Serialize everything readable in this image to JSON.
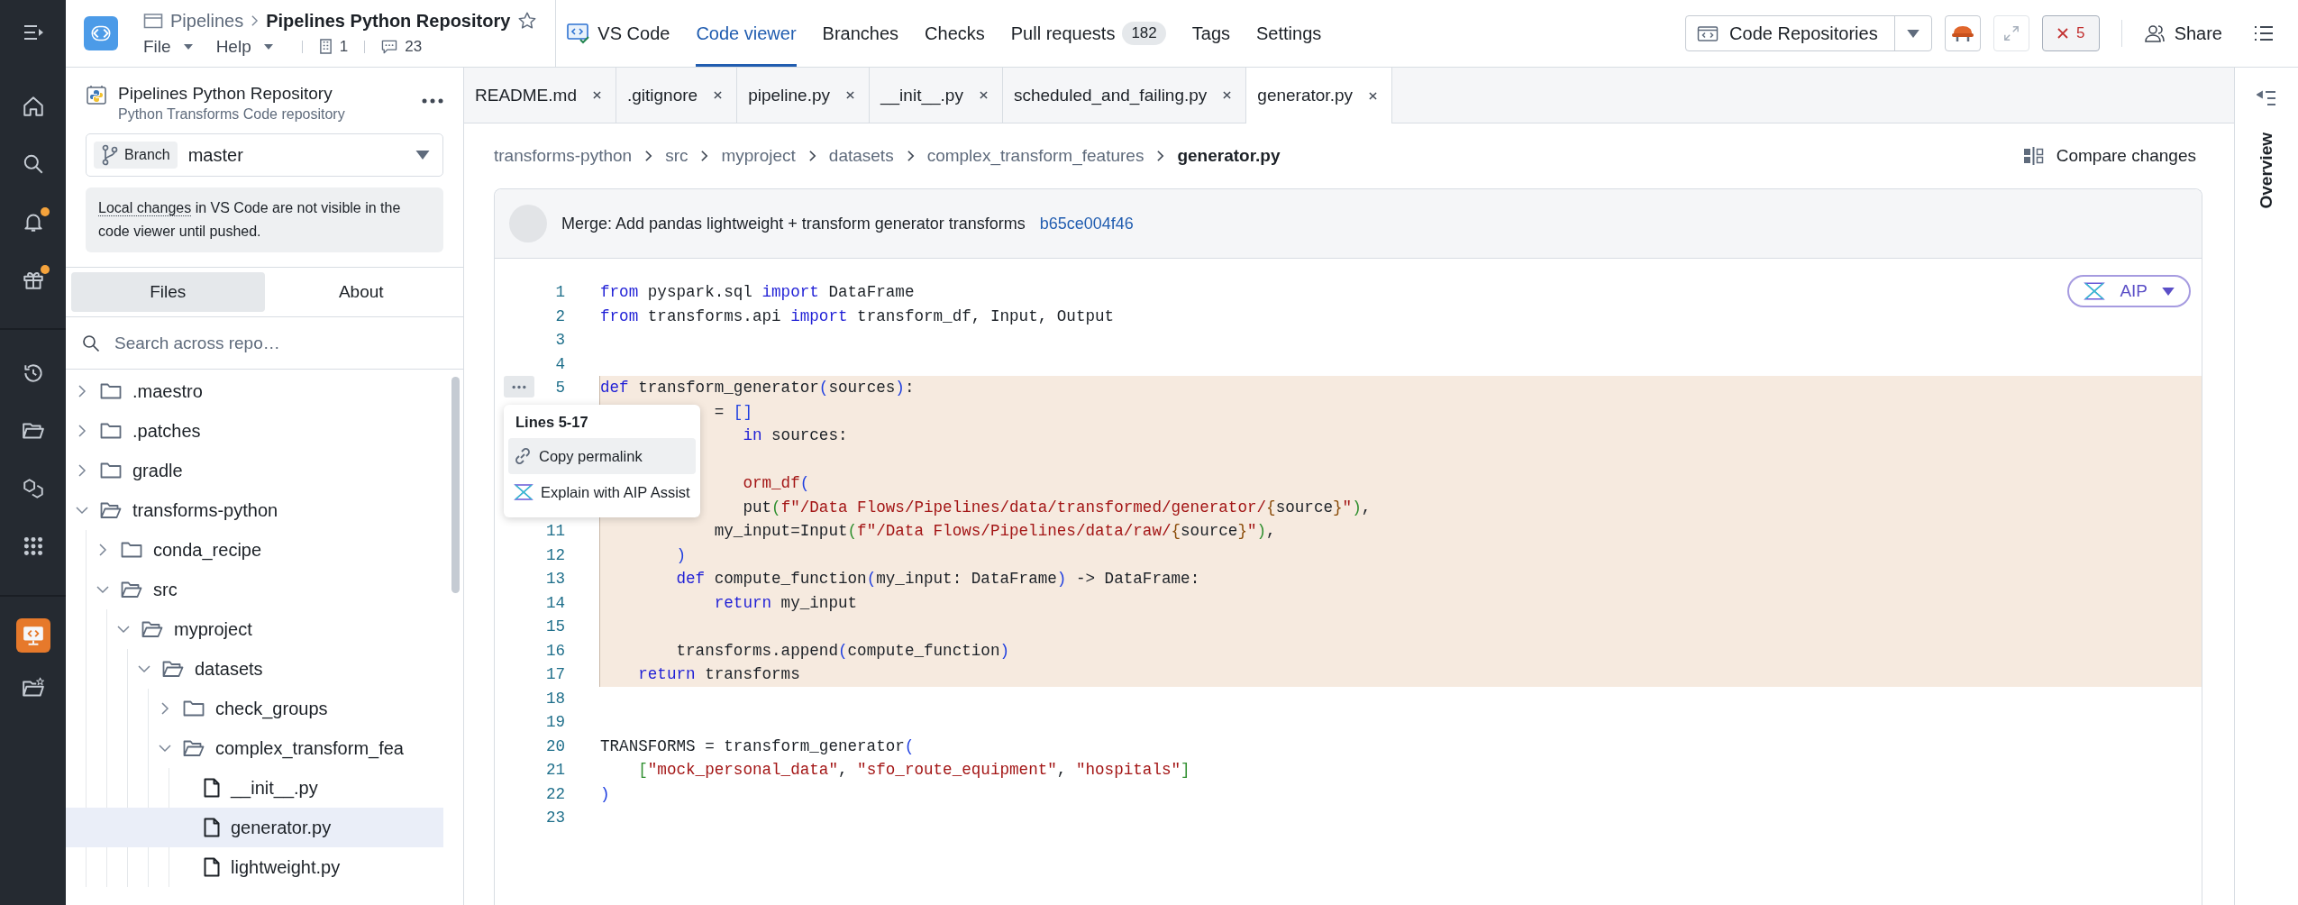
{
  "rail_items": [
    {
      "selected": false,
      "notification": false
    },
    {
      "selected": false,
      "notification": false
    },
    {
      "selected": false,
      "notification": true
    },
    {
      "selected": false,
      "notification": true
    },
    {
      "selected": false,
      "notification": false
    },
    {
      "selected": false,
      "notification": false
    },
    {
      "selected": false,
      "notification": false
    },
    {
      "selected": false,
      "notification": false
    },
    {
      "selected": true,
      "notification": false
    },
    {
      "selected": false,
      "notification": false
    }
  ],
  "header": {
    "breadcrumb_parent": "Pipelines",
    "title": "Pipelines Python Repository",
    "starred": false,
    "menus": [
      "File",
      "Help"
    ],
    "builds_count": "1",
    "comments_count": "23"
  },
  "nav_tabs": [
    {
      "label": "VS Code",
      "selected": false,
      "kind": "vscode"
    },
    {
      "label": "Code viewer",
      "selected": true
    },
    {
      "label": "Branches",
      "selected": false
    },
    {
      "label": "Checks",
      "selected": false
    },
    {
      "label": "Pull requests",
      "selected": false,
      "count": "182"
    },
    {
      "label": "Tags",
      "selected": false
    },
    {
      "label": "Settings",
      "selected": false
    }
  ],
  "toolbar": {
    "app_switcher": "Code Repositories",
    "error_count": "5",
    "share": "Share"
  },
  "sidebar": {
    "repo_name": "Pipelines Python Repository",
    "repo_type": "Python Transforms Code repository",
    "branch_label": "Branch",
    "branch": "master",
    "notice_link": "Local changes",
    "notice_text": "in VS Code are not visible in the code viewer until pushed.",
    "tabs": [
      {
        "label": "Files",
        "selected": true
      },
      {
        "label": "About",
        "selected": false
      }
    ],
    "search": {
      "placeholder": "Search across repo…"
    },
    "tree": [
      {
        "label": ".maestro",
        "kind": "folder",
        "expanded": false,
        "selected": false
      },
      {
        "label": ".patches",
        "kind": "folder",
        "expanded": false,
        "selected": false
      },
      {
        "label": "gradle",
        "kind": "folder",
        "expanded": false,
        "selected": false
      },
      {
        "label": "transforms-python",
        "kind": "folder",
        "expanded": true,
        "selected": false,
        "children": [
          {
            "label": "conda_recipe",
            "kind": "folder",
            "expanded": false,
            "selected": false
          },
          {
            "label": "src",
            "kind": "folder",
            "expanded": true,
            "selected": false,
            "children": [
              {
                "label": "myproject",
                "kind": "folder",
                "expanded": true,
                "selected": false,
                "children": [
                  {
                    "label": "datasets",
                    "kind": "folder",
                    "expanded": true,
                    "selected": false,
                    "children": [
                      {
                        "label": "check_groups",
                        "kind": "folder",
                        "expanded": false,
                        "selected": false
                      },
                      {
                        "label": "complex_transform_fea",
                        "kind": "folder",
                        "expanded": true,
                        "selected": false,
                        "children": [
                          {
                            "label": "__init__.py",
                            "kind": "file",
                            "selected": false
                          },
                          {
                            "label": "generator.py",
                            "kind": "file",
                            "selected": true
                          },
                          {
                            "label": "lightweight.py",
                            "kind": "file",
                            "selected": false
                          }
                        ]
                      }
                    ]
                  }
                ]
              }
            ]
          }
        ]
      }
    ]
  },
  "file_tabs": [
    {
      "label": "README.md",
      "selected": false
    },
    {
      "label": ".gitignore",
      "selected": false
    },
    {
      "label": "pipeline.py",
      "selected": false
    },
    {
      "label": "__init__.py",
      "selected": false
    },
    {
      "label": "scheduled_and_failing.py",
      "selected": false
    },
    {
      "label": "generator.py",
      "selected": true
    }
  ],
  "path": [
    "transforms-python",
    "src",
    "myproject",
    "datasets",
    "complex_transform_features",
    "generator.py"
  ],
  "compare_button": "Compare changes",
  "commit": {
    "message": "Merge: Add pandas lightweight + transform generator transforms",
    "hash": "b65ce004f46"
  },
  "aip_button": "AIP",
  "code_lines": [
    {
      "number": "1",
      "highlighted": false,
      "tokens": [
        {
          "kind": "kw",
          "text": "from"
        },
        {
          "kind": "txt",
          "text": " pyspark.sql "
        },
        {
          "kind": "kw",
          "text": "import"
        },
        {
          "kind": "txt",
          "text": " DataFrame"
        }
      ]
    },
    {
      "number": "2",
      "highlighted": false,
      "tokens": [
        {
          "kind": "kw",
          "text": "from"
        },
        {
          "kind": "txt",
          "text": " transforms.api "
        },
        {
          "kind": "kw",
          "text": "import"
        },
        {
          "kind": "txt",
          "text": " transform_df, Input, Output"
        }
      ]
    },
    {
      "number": "3",
      "highlighted": false
    },
    {
      "number": "4",
      "highlighted": false
    },
    {
      "number": "5",
      "highlighted": true,
      "tokens": [
        {
          "kind": "kw",
          "text": "def"
        },
        {
          "kind": "txt",
          "text": " transform_generator"
        },
        {
          "kind": "paren",
          "text": "("
        },
        {
          "kind": "txt",
          "text": "sources"
        },
        {
          "kind": "paren",
          "text": ")"
        },
        {
          "kind": "txt",
          "text": ":"
        }
      ]
    },
    {
      "highlighted": true,
      "tokens": [
        {
          "kind": "txt",
          "text": "            = "
        },
        {
          "kind": "paren",
          "text": "[]"
        }
      ]
    },
    {
      "highlighted": true,
      "tokens": [
        {
          "kind": "kw",
          "text": "               in"
        },
        {
          "kind": "txt",
          "text": " sources:"
        }
      ]
    },
    {
      "highlighted": true
    },
    {
      "highlighted": true,
      "tokens": [
        {
          "kind": "str",
          "text": "               orm_df"
        },
        {
          "kind": "paren",
          "text": "("
        }
      ]
    },
    {
      "highlighted": true,
      "tokens": [
        {
          "kind": "txt",
          "text": "               put"
        },
        {
          "kind": "bracket",
          "text": "("
        },
        {
          "kind": "str",
          "text": "f\"/Data Flows/Pipelines/data/transformed/generator/"
        },
        {
          "kind": "brace",
          "text": "{"
        },
        {
          "kind": "txt",
          "text": "source"
        },
        {
          "kind": "brace",
          "text": "}"
        },
        {
          "kind": "str",
          "text": "\""
        },
        {
          "kind": "bracket",
          "text": ")"
        },
        {
          "kind": "txt",
          "text": ","
        }
      ]
    },
    {
      "number": "11",
      "highlighted": true,
      "tokens": [
        {
          "kind": "txt",
          "text": "            my_input=Input"
        },
        {
          "kind": "bracket",
          "text": "("
        },
        {
          "kind": "str",
          "text": "f\"/Data Flows/Pipelines/data/raw/"
        },
        {
          "kind": "brace",
          "text": "{"
        },
        {
          "kind": "txt",
          "text": "source"
        },
        {
          "kind": "brace",
          "text": "}"
        },
        {
          "kind": "str",
          "text": "\""
        },
        {
          "kind": "bracket",
          "text": ")"
        },
        {
          "kind": "txt",
          "text": ","
        }
      ]
    },
    {
      "number": "12",
      "highlighted": true,
      "tokens": [
        {
          "kind": "paren",
          "text": "        )"
        }
      ]
    },
    {
      "number": "13",
      "highlighted": true,
      "tokens": [
        {
          "kind": "kw",
          "text": "        def"
        },
        {
          "kind": "txt",
          "text": " compute_function"
        },
        {
          "kind": "paren",
          "text": "("
        },
        {
          "kind": "txt",
          "text": "my_input: DataFrame"
        },
        {
          "kind": "paren",
          "text": ")"
        },
        {
          "kind": "txt",
          "text": " -> DataFrame:"
        }
      ]
    },
    {
      "number": "14",
      "highlighted": true,
      "tokens": [
        {
          "kind": "kw",
          "text": "            return"
        },
        {
          "kind": "txt",
          "text": " my_input"
        }
      ]
    },
    {
      "number": "15",
      "highlighted": true
    },
    {
      "number": "16",
      "highlighted": true,
      "tokens": [
        {
          "kind": "txt",
          "text": "        transforms.append"
        },
        {
          "kind": "paren",
          "text": "("
        },
        {
          "kind": "txt",
          "text": "compute_function"
        },
        {
          "kind": "paren",
          "text": ")"
        }
      ]
    },
    {
      "number": "17",
      "highlighted": true,
      "tokens": [
        {
          "kind": "kw",
          "text": "    return"
        },
        {
          "kind": "txt",
          "text": " transforms"
        }
      ]
    },
    {
      "number": "18",
      "highlighted": false
    },
    {
      "number": "19",
      "highlighted": false
    },
    {
      "number": "20",
      "highlighted": false,
      "tokens": [
        {
          "kind": "txt",
          "text": "TRANSFORMS = transform_generator"
        },
        {
          "kind": "paren",
          "text": "("
        }
      ]
    },
    {
      "number": "21",
      "highlighted": false,
      "tokens": [
        {
          "kind": "bracket",
          "text": "    ["
        },
        {
          "kind": "str",
          "text": "\"mock_personal_data\""
        },
        {
          "kind": "txt",
          "text": ", "
        },
        {
          "kind": "str",
          "text": "\"sfo_route_equipment\""
        },
        {
          "kind": "txt",
          "text": ", "
        },
        {
          "kind": "str",
          "text": "\"hospitals\""
        },
        {
          "kind": "bracket",
          "text": "]"
        }
      ]
    },
    {
      "number": "22",
      "highlighted": false,
      "tokens": [
        {
          "kind": "paren",
          "text": ")"
        }
      ]
    },
    {
      "number": "23",
      "highlighted": false
    }
  ],
  "line_menu": {
    "title": "Lines 5-17",
    "items": [
      {
        "label": "Copy permalink",
        "highlighted": true,
        "kind": "link"
      },
      {
        "label": "Explain with AIP Assist",
        "highlighted": false,
        "kind": "aip"
      }
    ]
  },
  "overview_label": "Overview"
}
